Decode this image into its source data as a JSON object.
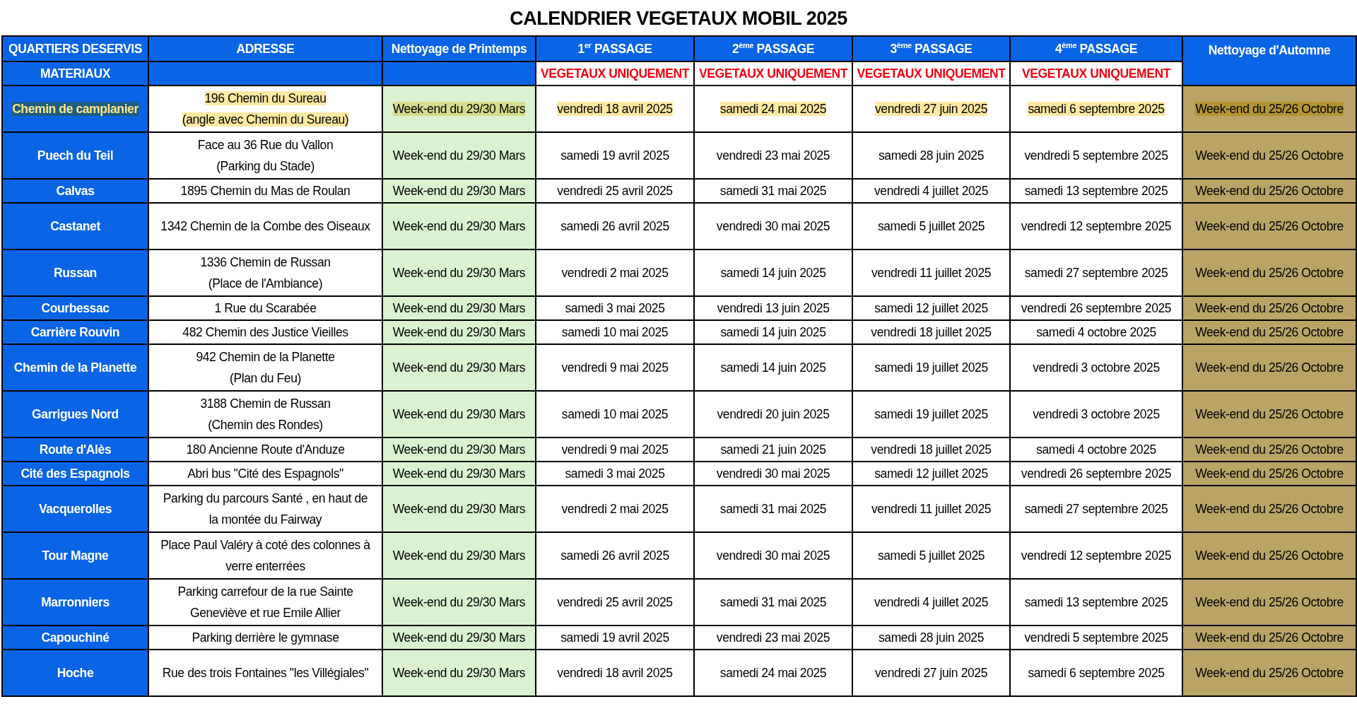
{
  "title": "CALENDRIER VEGETAUX MOBIL 2025",
  "columns": [
    "QUARTIERS DESERVIS",
    "ADRESSE",
    "Nettoyage de Printemps",
    "1$^{er}$ PASSAGE",
    "2$^{ème}$ PASSAGE",
    "3$^{ème}$ PASSAGE",
    "4$^{ème}$ PASSAGE",
    "Nettoyage d'Automne"
  ],
  "subheader": {
    "label": "MATERIAUX",
    "passages": [
      "VEGETAUX UNIQUEMENT",
      "VEGETAUX UNIQUEMENT",
      "VEGETAUX UNIQUEMENT",
      "VEGETAUX UNIQUEMENT"
    ]
  },
  "rows": [
    {
      "quartier": "Chemin de camplanier",
      "adresse": [
        "196 Chemin du Sureau",
        "(angle avec Chemin du Sureau)"
      ],
      "printemps": "Week-end du 29/30 Mars",
      "passages": [
        "vendredi 18 avril 2025",
        "samedi 24 mai 2025",
        "vendredi 27 juin 2025",
        "samedi 6 septembre 2025"
      ],
      "automne": "Week-end du 25/26 Octobre",
      "highlighted": true
    },
    {
      "quartier": "Puech du Teil",
      "adresse": [
        "Face au 36 Rue du Vallon",
        "(Parking du Stade)"
      ],
      "printemps": "Week-end du 29/30 Mars",
      "passages": [
        "samedi 19 avril 2025",
        "vendredi 23 mai 2025",
        "samedi 28 juin 2025",
        "vendredi 5 septembre 2025"
      ],
      "automne": "Week-end du 25/26 Octobre",
      "highlighted": false
    },
    {
      "quartier": "Calvas",
      "adresse": [
        "1895 Chemin du Mas de Roulan"
      ],
      "printemps": "Week-end du 29/30 Mars",
      "passages": [
        "vendredi 25 avril 2025",
        "samedi 31 mai 2025",
        "vendredi 4 juillet 2025",
        "samedi 13 septembre 2025"
      ],
      "automne": "Week-end du 25/26 Octobre",
      "highlighted": false
    },
    {
      "quartier": "Castanet",
      "adresse": [
        "1342 Chemin de la Combe des Oiseaux"
      ],
      "printemps": "Week-end du 29/30 Mars",
      "passages": [
        "samedi 26 avril 2025",
        "vendredi 30 mai 2025",
        "samedi 5 juillet 2025",
        "vendredi 12 septembre 2025"
      ],
      "automne": "Week-end du 25/26 Octobre",
      "highlighted": false,
      "tall": true
    },
    {
      "quartier": "Russan",
      "adresse": [
        "1336 Chemin de Russan",
        "(Place de l'Ambiance)"
      ],
      "printemps": "Week-end du 29/30 Mars",
      "passages": [
        "vendredi 2 mai 2025",
        "samedi 14 juin 2025",
        "vendredi 11 juillet 2025",
        "samedi 27 septembre 2025"
      ],
      "automne": "Week-end du 25/26 Octobre",
      "highlighted": false
    },
    {
      "quartier": "Courbessac",
      "adresse": [
        "1 Rue du Scarabée"
      ],
      "printemps": "Week-end du 29/30 Mars",
      "passages": [
        "samedi 3 mai 2025",
        "vendredi 13 juin 2025",
        "samedi 12 juillet 2025",
        "vendredi 26 septembre 2025"
      ],
      "automne": "Week-end du 25/26 Octobre",
      "highlighted": false
    },
    {
      "quartier": "Carrière Rouvin",
      "adresse": [
        "482 Chemin des Justice Vieilles"
      ],
      "printemps": "Week-end du 29/30 Mars",
      "passages": [
        "samedi 10 mai 2025",
        "samedi 14 juin 2025",
        "vendredi 18 juillet 2025",
        "samedi 4 octobre 2025"
      ],
      "automne": "Week-end du 25/26 Octobre",
      "highlighted": false
    },
    {
      "quartier": "Chemin de la Planette",
      "adresse": [
        "942 Chemin de la Planette",
        "(Plan du Feu)"
      ],
      "printemps": "Week-end du 29/30 Mars",
      "passages": [
        "vendredi 9 mai 2025",
        "samedi 14 juin 2025",
        "samedi 19 juillet 2025",
        "vendredi 3 octobre 2025"
      ],
      "automne": "Week-end du 25/26 Octobre",
      "highlighted": false
    },
    {
      "quartier": "Garrigues Nord",
      "adresse": [
        "3188 Chemin de Russan",
        "(Chemin des Rondes)"
      ],
      "printemps": "Week-end du 29/30 Mars",
      "passages": [
        "samedi 10 mai 2025",
        "vendredi 20 juin 2025",
        "samedi 19 juillet 2025",
        "vendredi 3 octobre 2025"
      ],
      "automne": "Week-end du 25/26 Octobre",
      "highlighted": false
    },
    {
      "quartier": "Route d'Alès",
      "adresse": [
        "180 Ancienne Route d'Anduze"
      ],
      "printemps": "Week-end du 29/30 Mars",
      "passages": [
        "vendredi 9 mai 2025",
        "samedi 21 juin 2025",
        "vendredi 18 juillet 2025",
        "samedi 4 octobre 2025"
      ],
      "automne": "Week-end du 25/26 Octobre",
      "highlighted": false
    },
    {
      "quartier": "Cité des Espagnols",
      "adresse": [
        "Abri bus \"Cité des Espagnols\""
      ],
      "printemps": "Week-end du 29/30 Mars",
      "passages": [
        "samedi 3 mai 2025",
        "vendredi 30 mai 2025",
        "samedi 12 juillet 2025",
        "vendredi 26 septembre 2025"
      ],
      "automne": "Week-end du 25/26 Octobre",
      "highlighted": false
    },
    {
      "quartier": "Vacquerolles",
      "adresse": [
        "Parking du parcours Santé , en haut de",
        "la montée du Fairway"
      ],
      "printemps": "Week-end du 29/30 Mars",
      "passages": [
        "vendredi 2 mai 2025",
        "samedi 31 mai 2025",
        "vendredi 11 juillet 2025",
        "samedi 27 septembre 2025"
      ],
      "automne": "Week-end du 25/26 Octobre",
      "highlighted": false
    },
    {
      "quartier": "Tour Magne",
      "adresse": [
        "Place Paul Valéry à coté des colonnes à",
        "verre enterrées"
      ],
      "printemps": "Week-end du 29/30 Mars",
      "passages": [
        "samedi 26 avril 2025",
        "vendredi 30 mai 2025",
        "samedi 5 juillet 2025",
        "vendredi 12 septembre 2025"
      ],
      "automne": "Week-end du 25/26 Octobre",
      "highlighted": false
    },
    {
      "quartier": "Marronniers",
      "adresse": [
        "Parking carrefour de la rue Sainte",
        "Geneviève et rue Emile Allier"
      ],
      "printemps": "Week-end du 29/30 Mars",
      "passages": [
        "vendredi 25 avril 2025",
        "samedi 31 mai 2025",
        "vendredi 4 juillet 2025",
        "samedi 13 septembre 2025"
      ],
      "automne": "Week-end du 25/26 Octobre",
      "highlighted": false
    },
    {
      "quartier": "Capouchiné",
      "adresse": [
        "Parking derrière le gymnase"
      ],
      "printemps": "Week-end du 29/30 Mars",
      "passages": [
        "samedi 19 avril 2025",
        "vendredi 23 mai 2025",
        "samedi 28 juin 2025",
        "vendredi 5 septembre 2025"
      ],
      "automne": "Week-end du 25/26 Octobre",
      "highlighted": false
    },
    {
      "quartier": "Hoche",
      "adresse": [
        "Rue des trois Fontaines \"les Villégiales\""
      ],
      "printemps": "Week-end du 29/30 Mars",
      "passages": [
        "vendredi 18 avril 2025",
        "samedi 24 mai 2025",
        "vendredi 27 juin 2025",
        "samedi 6 septembre 2025"
      ],
      "automne": "Week-end du 25/26 Octobre",
      "highlighted": false,
      "tall": true
    }
  ]
}
